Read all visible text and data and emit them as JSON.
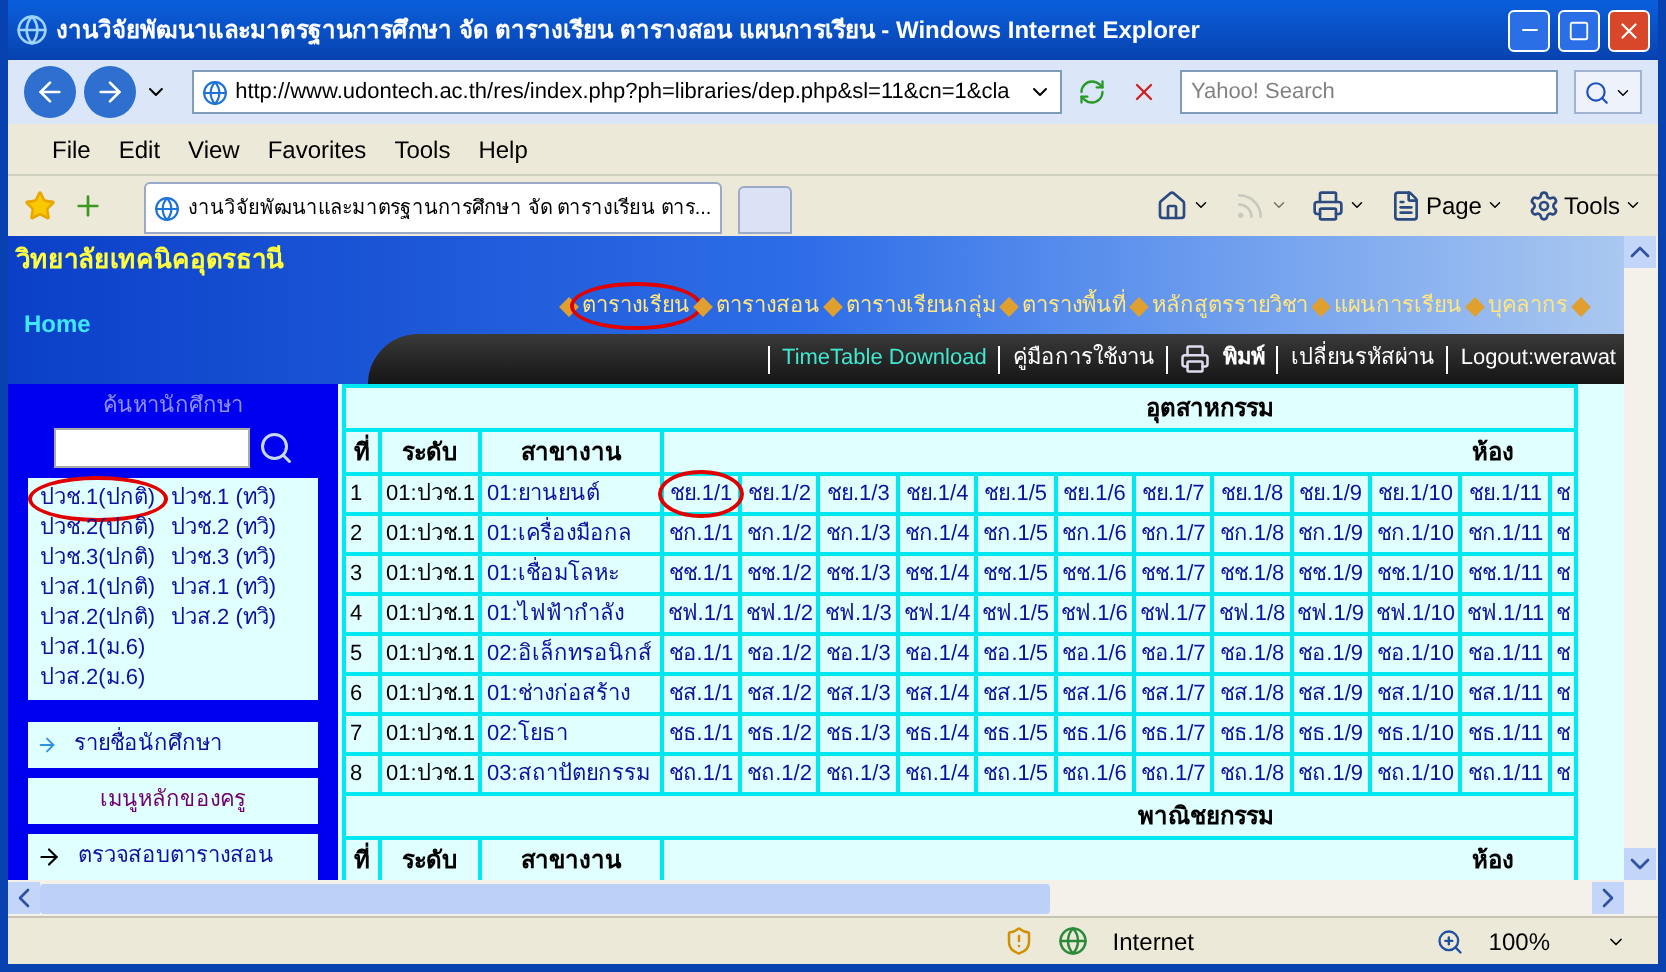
{
  "window": {
    "title": "งานวิจัยพัฒนาและมาตรฐานการศึกษา จัด ตารางเรียน ตารางสอน แผนการเรียน - Windows Internet Explorer"
  },
  "address_bar": {
    "url": "http://www.udontech.ac.th/res/index.php?ph=libraries/dep.php&sl=11&cn=1&cla",
    "search_placeholder": "Yahoo! Search"
  },
  "menu": [
    "File",
    "Edit",
    "View",
    "Favorites",
    "Tools",
    "Help"
  ],
  "tabs": [
    {
      "label": "งานวิจัยพัฒนาและมาตรฐานการศึกษา จัด ตารางเรียน ตาร...",
      "selected": true
    }
  ],
  "command_bar": [
    {
      "kind": "home",
      "disabled": false
    },
    {
      "kind": "feeds",
      "disabled": true
    },
    {
      "kind": "print",
      "disabled": false
    },
    {
      "kind": "page",
      "label": "Page",
      "disabled": false
    },
    {
      "kind": "tools",
      "label": "Tools",
      "disabled": false
    }
  ],
  "site": {
    "name": "วิทยาลัยเทคนิคอุดรธานี",
    "home": "Home",
    "nav": [
      {
        "label": "ตารางเรียน",
        "circled": true
      },
      {
        "label": "ตารางสอน",
        "circled": false
      },
      {
        "label": "ตารางเรียนกลุ่ม",
        "circled": false
      },
      {
        "label": "ตารางพื้นที่",
        "circled": false
      },
      {
        "label": "หลักสูตรรายวิชา",
        "circled": false
      },
      {
        "label": "แผนการเรียน",
        "circled": false
      },
      {
        "label": "บุคลากร",
        "circled": false
      }
    ],
    "links": [
      {
        "kind": "download",
        "label": "TimeTable Download"
      },
      {
        "kind": "plain",
        "label": "คู่มือการใช้งาน"
      },
      {
        "kind": "print",
        "label": "พิมพ์"
      },
      {
        "kind": "plain",
        "label": "เปลี่ยนรหัสผ่าน"
      },
      {
        "kind": "plain",
        "label": "Logout:werawat"
      }
    ]
  },
  "sidebar": {
    "search_title": "ค้นหานักศึกษา",
    "classes": [
      [
        {
          "label": "ปวช.1(ปกติ)",
          "circled": true
        },
        {
          "label": "ปวช.1 (ทวิ)",
          "circled": false
        }
      ],
      [
        {
          "label": "ปวช.2(ปกติ)",
          "circled": false
        },
        {
          "label": "ปวช.2 (ทวิ)",
          "circled": false
        }
      ],
      [
        {
          "label": "ปวช.3(ปกติ)",
          "circled": false
        },
        {
          "label": "ปวช.3 (ทวิ)",
          "circled": false
        }
      ],
      [
        {
          "label": "ปวส.1(ปกติ)",
          "circled": false
        },
        {
          "label": "ปวส.1 (ทวิ)",
          "circled": false
        }
      ],
      [
        {
          "label": "ปวส.2(ปกติ)",
          "circled": false
        },
        {
          "label": "ปวส.2 (ทวิ)",
          "circled": false
        }
      ],
      [
        {
          "label": "ปวส.1(ม.6)",
          "circled": false
        }
      ],
      [
        {
          "label": "ปวส.2(ม.6)",
          "circled": false
        }
      ]
    ],
    "student_list": "รายชื่อนักศึกษา",
    "teacher_menu": "เมนูหลักของครู",
    "check_schedule": "ตรวจสอบตารางสอน"
  },
  "sections": [
    {
      "title": "อุตสาหกรรม",
      "columns": [
        "ที่",
        "ระดับ",
        "สาขางาน",
        "ห้อง"
      ],
      "rows": [
        {
          "no": "1",
          "level": "01:ปวช.1",
          "major": "01:ยานยนต์",
          "circle_first_room": true,
          "rooms": [
            "ชย.1/1",
            "ชย.1/2",
            "ชย.1/3",
            "ชย.1/4",
            "ชย.1/5",
            "ชย.1/6",
            "ชย.1/7",
            "ชย.1/8",
            "ชย.1/9",
            "ชย.1/10",
            "ชย.1/11",
            "ช"
          ]
        },
        {
          "no": "2",
          "level": "01:ปวช.1",
          "major": "01:เครื่องมือกล",
          "rooms": [
            "ชก.1/1",
            "ชก.1/2",
            "ชก.1/3",
            "ชก.1/4",
            "ชก.1/5",
            "ชก.1/6",
            "ชก.1/7",
            "ชก.1/8",
            "ชก.1/9",
            "ชก.1/10",
            "ชก.1/11",
            "ช"
          ]
        },
        {
          "no": "3",
          "level": "01:ปวช.1",
          "major": "01:เชื่อมโลหะ",
          "rooms": [
            "ชช.1/1",
            "ชช.1/2",
            "ชช.1/3",
            "ชช.1/4",
            "ชช.1/5",
            "ชช.1/6",
            "ชช.1/7",
            "ชช.1/8",
            "ชช.1/9",
            "ชช.1/10",
            "ชช.1/11",
            "ช"
          ]
        },
        {
          "no": "4",
          "level": "01:ปวช.1",
          "major": "01:ไฟฟ้ากำลัง",
          "rooms": [
            "ชฟ.1/1",
            "ชฟ.1/2",
            "ชฟ.1/3",
            "ชฟ.1/4",
            "ชฟ.1/5",
            "ชฟ.1/6",
            "ชฟ.1/7",
            "ชฟ.1/8",
            "ชฟ.1/9",
            "ชฟ.1/10",
            "ชฟ.1/11",
            "ช"
          ]
        },
        {
          "no": "5",
          "level": "01:ปวช.1",
          "major": "02:อิเล็กทรอนิกส์",
          "rooms": [
            "ชอ.1/1",
            "ชอ.1/2",
            "ชอ.1/3",
            "ชอ.1/4",
            "ชอ.1/5",
            "ชอ.1/6",
            "ชอ.1/7",
            "ชอ.1/8",
            "ชอ.1/9",
            "ชอ.1/10",
            "ชอ.1/11",
            "ช"
          ]
        },
        {
          "no": "6",
          "level": "01:ปวช.1",
          "major": "01:ช่างก่อสร้าง",
          "rooms": [
            "ชส.1/1",
            "ชส.1/2",
            "ชส.1/3",
            "ชส.1/4",
            "ชส.1/5",
            "ชส.1/6",
            "ชส.1/7",
            "ชส.1/8",
            "ชส.1/9",
            "ชส.1/10",
            "ชส.1/11",
            "ช"
          ]
        },
        {
          "no": "7",
          "level": "01:ปวช.1",
          "major": "02:โยธา",
          "rooms": [
            "ชธ.1/1",
            "ชธ.1/2",
            "ชธ.1/3",
            "ชธ.1/4",
            "ชธ.1/5",
            "ชธ.1/6",
            "ชธ.1/7",
            "ชธ.1/8",
            "ชธ.1/9",
            "ชธ.1/10",
            "ชธ.1/11",
            "ช"
          ]
        },
        {
          "no": "8",
          "level": "01:ปวช.1",
          "major": "03:สถาปัตยกรรม",
          "rooms": [
            "ชถ.1/1",
            "ชถ.1/2",
            "ชถ.1/3",
            "ชถ.1/4",
            "ชถ.1/5",
            "ชถ.1/6",
            "ชถ.1/7",
            "ชถ.1/8",
            "ชถ.1/9",
            "ชถ.1/10",
            "ชถ.1/11",
            "ช"
          ]
        }
      ]
    },
    {
      "title": "พาณิชยกรรม",
      "columns": [
        "ที่",
        "ระดับ",
        "สาขางาน",
        "ห้อง"
      ]
    }
  ],
  "status_bar": {
    "zone": "Internet",
    "zoom": "100%"
  }
}
